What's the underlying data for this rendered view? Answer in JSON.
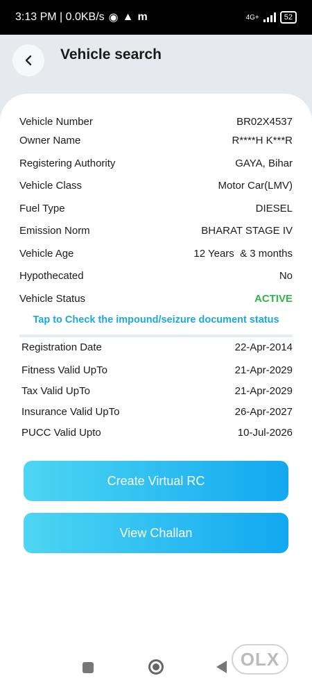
{
  "status_bar": {
    "time_speed": "3:13 PM | 0.0KB/s",
    "app_letter": "m",
    "network": "4G+",
    "battery": "52"
  },
  "header": {
    "title": "Vehicle search"
  },
  "details": [
    {
      "label": "Vehicle Number",
      "value": "BR02X4537"
    },
    {
      "label": "Owner Name",
      "value": "R****H K***R"
    },
    {
      "label": "Registering Authority",
      "value": "GAYA, Bihar"
    },
    {
      "label": "Vehicle Class",
      "value": "Motor Car(LMV)"
    },
    {
      "label": "Fuel Type",
      "value": "DIESEL"
    },
    {
      "label": "Emission Norm",
      "value": "BHARAT STAGE IV"
    },
    {
      "label": "Vehicle Age",
      "value": "12 Years  & 3 months"
    },
    {
      "label": "Hypothecated",
      "value": "No"
    },
    {
      "label": "Vehicle Status",
      "value": "ACTIVE"
    }
  ],
  "impound_link": "Tap to Check the impound/seizure document status",
  "validity": [
    {
      "label": "Registration Date",
      "value": "22-Apr-2014"
    },
    {
      "label": "Fitness Valid UpTo",
      "value": "21-Apr-2029"
    },
    {
      "label": "Tax Valid UpTo",
      "value": "21-Apr-2029"
    },
    {
      "label": "Insurance Valid UpTo",
      "value": "26-Apr-2027"
    },
    {
      "label": "PUCC Valid Upto",
      "value": "10-Jul-2026"
    }
  ],
  "buttons": {
    "virtual_rc": "Create Virtual RC",
    "challan": "View Challan"
  },
  "watermark": "OLX",
  "colors": {
    "accent": "#12a8f0",
    "active": "#2fb54a",
    "link": "#1aa9dd"
  },
  "icons": [
    "back-arrow-icon",
    "signal-icon",
    "battery-icon",
    "recents-icon",
    "home-icon",
    "back-icon"
  ]
}
